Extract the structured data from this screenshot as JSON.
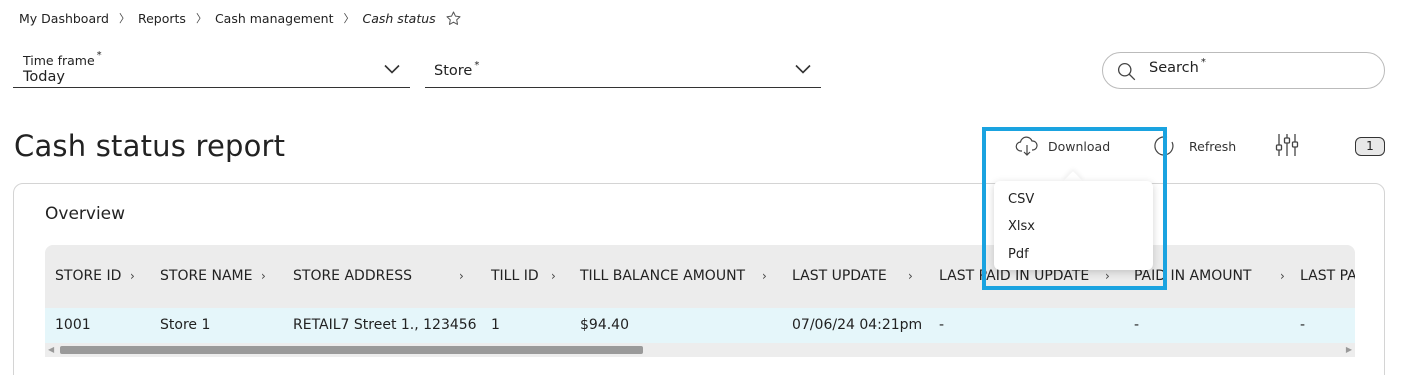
{
  "breadcrumb": {
    "items": [
      "My Dashboard",
      "Reports",
      "Cash management"
    ],
    "current": "Cash status"
  },
  "filters": {
    "timeframe_label": "Time frame",
    "timeframe_value": "Today",
    "store_label": "Store",
    "required_mark": "*"
  },
  "search": {
    "label": "Search",
    "required_mark": "*"
  },
  "page_title": "Cash status report",
  "toolbar": {
    "download_label": "Download",
    "refresh_label": "Refresh",
    "filter_count": "1"
  },
  "download_menu": {
    "options": [
      "CSV",
      "Xlsx",
      "Pdf"
    ]
  },
  "overview": {
    "title": "Overview",
    "columns": [
      "STORE ID",
      "STORE NAME",
      "STORE ADDRESS",
      "TILL ID",
      "TILL BALANCE AMOUNT",
      "LAST UPDATE",
      "LAST PAID IN UPDATE",
      "PAID IN AMOUNT",
      "LAST PA"
    ],
    "rows": [
      [
        "1001",
        "Store 1",
        "RETAIL7 Street 1., 123456",
        "1",
        "$94.40",
        "07/06/24 04:21pm",
        "-",
        "-",
        "-"
      ]
    ]
  },
  "colors": {
    "highlight": "#1aa3e0",
    "header_bg": "#ececec",
    "row_bg": "#e5f6fa"
  },
  "icons": {
    "star": "star-icon",
    "chevron": "chevron-down-icon",
    "search": "search-icon",
    "download": "cloud-download-icon",
    "refresh": "refresh-icon",
    "filters": "sliders-icon"
  }
}
